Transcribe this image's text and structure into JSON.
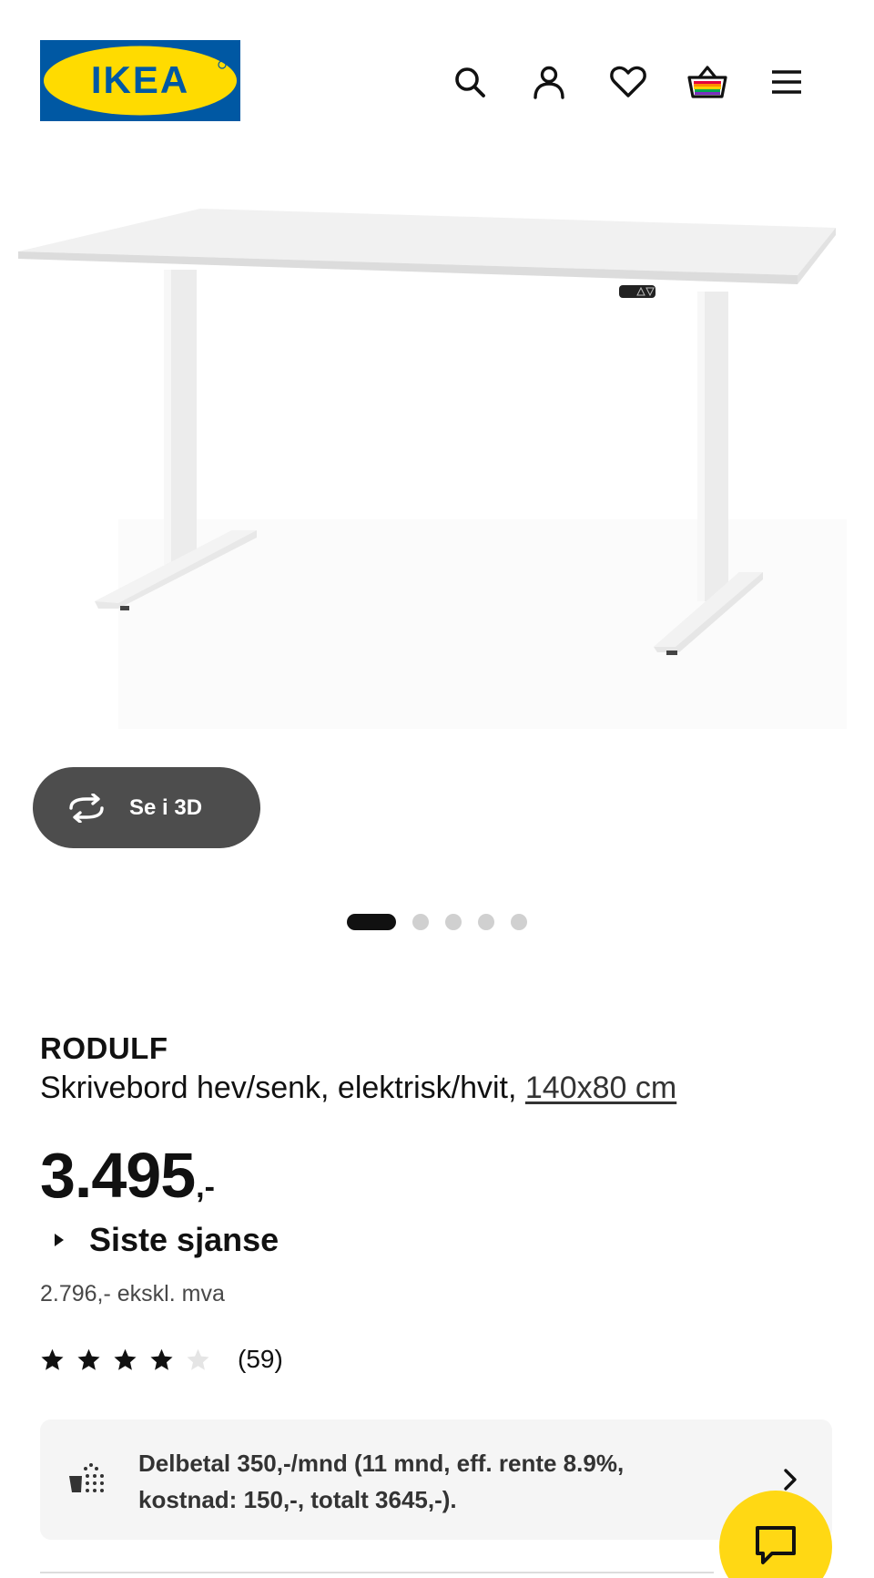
{
  "header": {
    "logo_text": "IKEA",
    "icons": [
      "search-icon",
      "account-icon",
      "heart-icon",
      "basket-icon",
      "menu-icon"
    ],
    "brand_colors": {
      "blue": "#0058a3",
      "yellow": "#ffdb00"
    }
  },
  "product_image": {
    "alt": ""
  },
  "view_3d": {
    "label": "Se i 3D",
    "icon": "rotate-360-icon"
  },
  "carousel": {
    "count": 5,
    "active_index": 0
  },
  "product": {
    "name": "RODULF",
    "description": "Skrivebord hev/senk, elektrisk/hvit,",
    "size_link": "140x80 cm",
    "price_int": "3.495",
    "price_suffix": ",-",
    "last_chance": "Siste sjanse",
    "price_ex_vat": "2.796,- ekskl. mva",
    "rating": 4,
    "rating_max": 5,
    "review_count": "(59)"
  },
  "financing": {
    "text": "Delbetal 350,-/mnd (11 mnd, eff. rente 8.9%, kostnad: 150,-, totalt 3645,-).",
    "icon": "basket-payment-icon"
  },
  "chat": {
    "icon": "chat-bubble-icon",
    "color": "#ffd814"
  }
}
